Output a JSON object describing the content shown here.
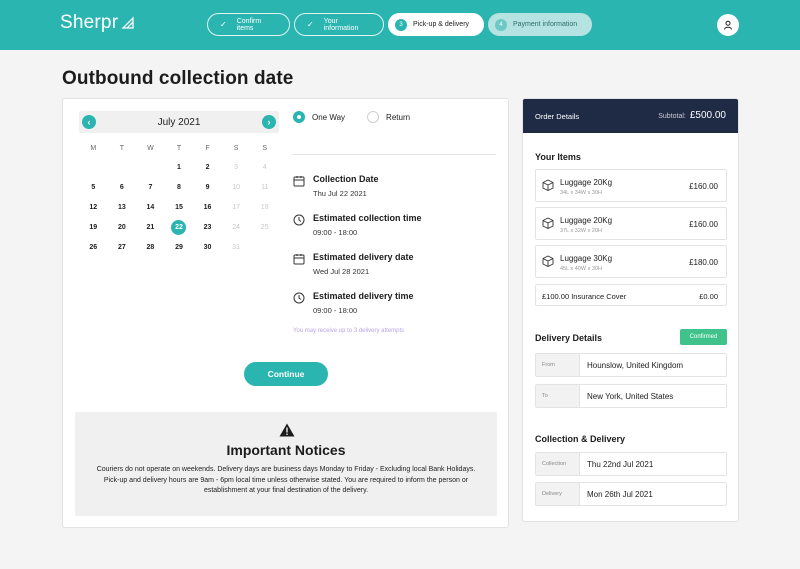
{
  "header": {
    "logo": "Sherpr",
    "steps": [
      {
        "label": "Confirm items",
        "state": "done",
        "icon": "check-icon"
      },
      {
        "label": "Your information",
        "state": "done",
        "icon": "check-icon"
      },
      {
        "label": "Pick-up & delivery",
        "state": "active",
        "number": "3"
      },
      {
        "label": "Payment information",
        "state": "upcoming",
        "number": "4"
      }
    ],
    "user_icon": "user-icon"
  },
  "page": {
    "title": "Outbound collection date"
  },
  "calendar": {
    "month": "July 2021",
    "weekdays": [
      "M",
      "T",
      "W",
      "T",
      "F",
      "S",
      "S"
    ],
    "weeks": [
      [
        {
          "d": "",
          "m": false
        },
        {
          "d": "",
          "m": false
        },
        {
          "d": "",
          "m": false
        },
        {
          "d": "1",
          "m": false
        },
        {
          "d": "2",
          "m": false
        },
        {
          "d": "3",
          "m": true
        },
        {
          "d": "4",
          "m": true
        }
      ],
      [
        {
          "d": "5",
          "m": false
        },
        {
          "d": "6",
          "m": false
        },
        {
          "d": "7",
          "m": false
        },
        {
          "d": "8",
          "m": false
        },
        {
          "d": "9",
          "m": false
        },
        {
          "d": "10",
          "m": true
        },
        {
          "d": "11",
          "m": true
        }
      ],
      [
        {
          "d": "12",
          "m": false
        },
        {
          "d": "13",
          "m": false
        },
        {
          "d": "14",
          "m": false
        },
        {
          "d": "15",
          "m": false
        },
        {
          "d": "16",
          "m": false
        },
        {
          "d": "17",
          "m": true
        },
        {
          "d": "18",
          "m": true
        }
      ],
      [
        {
          "d": "19",
          "m": false
        },
        {
          "d": "20",
          "m": false
        },
        {
          "d": "21",
          "m": false
        },
        {
          "d": "22",
          "m": false,
          "sel": true
        },
        {
          "d": "23",
          "m": false
        },
        {
          "d": "24",
          "m": true
        },
        {
          "d": "25",
          "m": true
        }
      ],
      [
        {
          "d": "26",
          "m": false
        },
        {
          "d": "27",
          "m": false
        },
        {
          "d": "28",
          "m": false
        },
        {
          "d": "29",
          "m": false
        },
        {
          "d": "30",
          "m": false
        },
        {
          "d": "31",
          "m": true
        },
        {
          "d": "",
          "m": false
        }
      ]
    ]
  },
  "trip": {
    "one_way": "One Way",
    "return": "Return",
    "selected": "One Way"
  },
  "schedule": {
    "collection_date_label": "Collection Date",
    "collection_date": "Thu Jul 22 2021",
    "collection_time_label": "Estimated collection time",
    "collection_time": "09:00 - 18:00",
    "delivery_date_label": "Estimated delivery date",
    "delivery_date": "Wed Jul 28 2021",
    "delivery_time_label": "Estimated delivery time",
    "delivery_time": "09:00 - 18:00",
    "note": "You may receive up to 3 delivery attempts"
  },
  "continue_label": "Continue",
  "notice": {
    "title": "Important Notices",
    "body": "Couriers do not operate on weekends. Delivery days are business days Monday to Friday - Excluding local Bank Holidays. Pick-up and delivery hours are 9am - 6pm local time unless otherwise stated. You are required to inform the person or establishment at your final destination of the delivery."
  },
  "order": {
    "title": "Order Details",
    "subtotal_label": "Subtotal:",
    "subtotal": "£500.00",
    "items_title": "Your Items",
    "items": [
      {
        "name": "Luggage 20Kg",
        "dims": "34L x 34W x 30H",
        "price": "£160.00"
      },
      {
        "name": "Luggage 20Kg",
        "dims": "37L x 32W x 20H",
        "price": "£160.00"
      },
      {
        "name": "Luggage 30Kg",
        "dims": "45L x 40W x 30H",
        "price": "£180.00"
      }
    ],
    "insurance": {
      "name": "£100.00 Insurance Cover",
      "price": "£0.00"
    },
    "delivery_title": "Delivery Details",
    "confirmed": "Confirmed",
    "from_label": "From",
    "from": "Hounslow, United Kingdom",
    "to_label": "To",
    "to": "New York, United States",
    "cd_title": "Collection & Delivery",
    "collection_label": "Collection",
    "collection": "Thu 22nd Jul 2021",
    "delivery_label": "Delivery",
    "delivery": "Mon 26th Jul 2021"
  },
  "colors": {
    "accent": "#2bb5b0",
    "dark": "#1f2a44",
    "success": "#3fc38a"
  }
}
